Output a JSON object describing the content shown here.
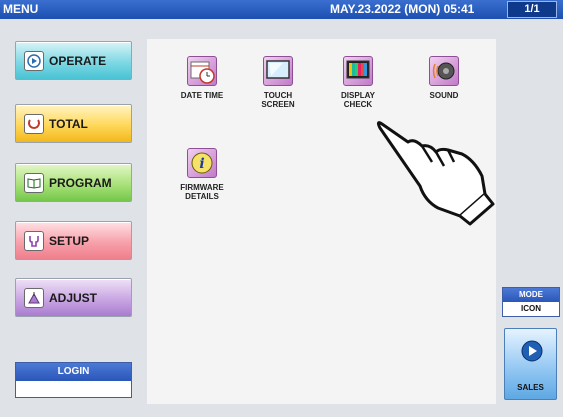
{
  "header": {
    "title": "MENU",
    "datetime": "MAY.23.2022 (MON) 05:41",
    "page": "1/1"
  },
  "sidebar": {
    "buttons": [
      {
        "label": "OPERATE",
        "icon": "play-icon"
      },
      {
        "label": "TOTAL",
        "icon": "total-icon"
      },
      {
        "label": "PROGRAM",
        "icon": "book-icon"
      },
      {
        "label": "SETUP",
        "icon": "wrench-icon"
      },
      {
        "label": "ADJUST",
        "icon": "adjust-icon"
      }
    ],
    "login_label": "LOGIN",
    "login_value": ""
  },
  "menu_items": [
    {
      "label": "DATE TIME",
      "icon": "calendar-clock-icon"
    },
    {
      "label": "TOUCH\nSCREEN",
      "icon": "monitor-icon"
    },
    {
      "label": "DISPLAY\nCHECK",
      "icon": "color-bars-icon"
    },
    {
      "label": "SOUND",
      "icon": "speaker-icon"
    },
    {
      "label": "FIRMWARE\nDETAILS",
      "icon": "info-icon"
    }
  ],
  "mode": {
    "label": "MODE",
    "value": "ICON"
  },
  "sales": {
    "label": "SALES",
    "icon": "play-circle-icon"
  },
  "colors": {
    "title_bar": "#1c4fb0",
    "operate": "#48c3d4",
    "total": "#f2b81c",
    "program": "#74c74a",
    "setup": "#ef7f8c",
    "adjust": "#a97ccf"
  }
}
